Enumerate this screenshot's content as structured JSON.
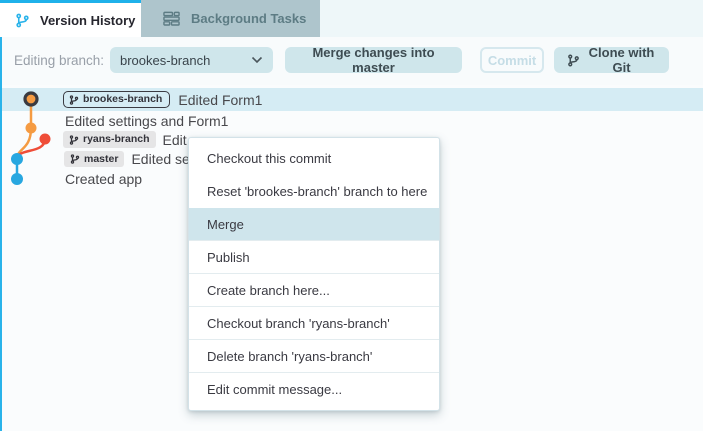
{
  "tabs": {
    "version_history": "Version History",
    "background_tasks": "Background Tasks"
  },
  "toolbar": {
    "editing_branch_label": "Editing branch:",
    "branch_select_value": "brookes-branch",
    "merge_button": "Merge changes into master",
    "commit_button": "Commit",
    "clone_button": "Clone with Git"
  },
  "commits": [
    {
      "badge": "brookes-branch",
      "message": "Edited Form1",
      "node": "orange-ring",
      "selected": true
    },
    {
      "badge": "",
      "message": "Edited settings and Form1",
      "node": "orange"
    },
    {
      "badge": "ryans-branch",
      "message": "Edit",
      "node": "red"
    },
    {
      "badge": "master",
      "message": "Edited se",
      "node": "blue"
    },
    {
      "badge": "",
      "message": "Created app",
      "node": "blue"
    }
  ],
  "context_menu": {
    "items": [
      "Checkout this commit",
      "Reset 'brookes-branch' branch to here",
      "Merge",
      "Publish",
      "Create branch here...",
      "Checkout branch 'ryans-branch'",
      "Delete branch 'ryans-branch'",
      "Edit commit message..."
    ],
    "highlighted_item": "Merge"
  },
  "colors": {
    "accent_blue": "#29b3ea",
    "active_tab_border": "#1fb1ea",
    "inactive_tab_bg": "#aec5cc",
    "button_bg": "#cfe6eb",
    "row_highlight": "#d5ecf4",
    "menu_highlight": "#cfe5ec",
    "graph_orange": "#f59b42",
    "graph_red": "#ef4d38",
    "graph_blue": "#27a7e0"
  }
}
